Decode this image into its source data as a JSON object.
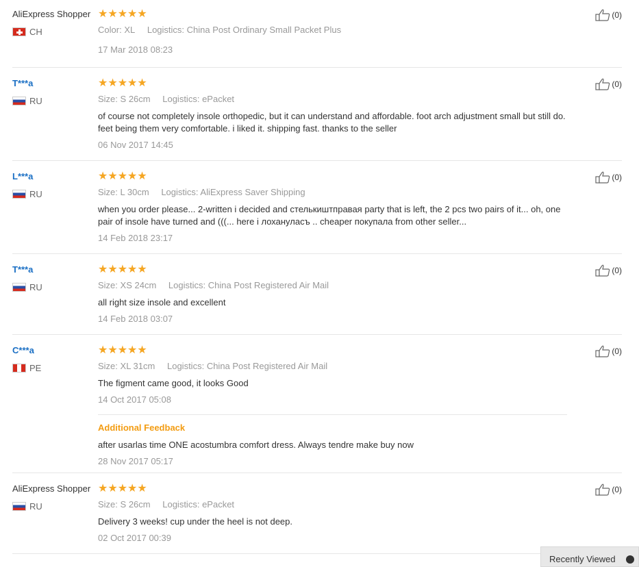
{
  "reviews": [
    {
      "user": "AliExpress Shopper",
      "masked": false,
      "country": "CH",
      "flag": "ch",
      "stars": 5,
      "attr_label": "Color:",
      "attr_value": "XL",
      "logistics_label": "Logistics:",
      "logistics_value": "China Post Ordinary Small Packet Plus",
      "text": "",
      "date": "17 Mar 2018 08:23",
      "helpful": "(0)"
    },
    {
      "user": "T***a",
      "masked": true,
      "country": "RU",
      "flag": "ru",
      "stars": 5,
      "attr_label": "Size:",
      "attr_value": "S 26cm",
      "logistics_label": "Logistics:",
      "logistics_value": "ePacket",
      "text": "of course not completely insole orthopedic, but it can understand and affordable. foot arch adjustment small but still do. feet being them very comfortable. i liked it. shipping fast. thanks to the seller",
      "date": "06 Nov 2017 14:45",
      "helpful": "(0)"
    },
    {
      "user": "L***a",
      "masked": true,
      "country": "RU",
      "flag": "ru",
      "stars": 5,
      "attr_label": "Size:",
      "attr_value": "L 30cm",
      "logistics_label": "Logistics:",
      "logistics_value": "AliExpress Saver Shipping",
      "text": "when you order please... 2-written i decided and стелькиштправая party that is left, the 2 pcs two pairs of it... oh, one pair of insole have turned and (((... here i лохануласъ .. cheaper покупала from other seller...",
      "date": "14 Feb 2018 23:17",
      "helpful": "(0)"
    },
    {
      "user": "T***a",
      "masked": true,
      "country": "RU",
      "flag": "ru",
      "stars": 5,
      "attr_label": "Size:",
      "attr_value": "XS 24cm",
      "logistics_label": "Logistics:",
      "logistics_value": "China Post Registered Air Mail",
      "text": "all right size insole and excellent",
      "date": "14 Feb 2018 03:07",
      "helpful": "(0)"
    },
    {
      "user": "C***a",
      "masked": true,
      "country": "PE",
      "flag": "pe",
      "stars": 5,
      "attr_label": "Size:",
      "attr_value": "XL 31cm",
      "logistics_label": "Logistics:",
      "logistics_value": "China Post Registered Air Mail",
      "text": "The figment came good, it looks Good",
      "date": "14 Oct 2017 05:08",
      "helpful": "(0)",
      "additional_title": "Additional Feedback",
      "additional_text": "after usarlas time ONE acostumbra comfort dress. Always tendre make buy now",
      "additional_date": "28 Nov 2017 05:17"
    },
    {
      "user": "AliExpress Shopper",
      "masked": false,
      "country": "RU",
      "flag": "ru",
      "stars": 5,
      "attr_label": "Size:",
      "attr_value": "S 26cm",
      "logistics_label": "Logistics:",
      "logistics_value": "ePacket",
      "text": "Delivery 3 weeks! cup under the heel is not deep.",
      "date": "02 Oct 2017 00:39",
      "helpful": "(0)"
    }
  ],
  "recently_viewed": "Recently Viewed",
  "colors": {
    "star": "#f5a623",
    "user_link": "#1a6fc4",
    "additional": "#f39c12"
  },
  "icons": {
    "helpful": "thumbs-up-icon",
    "star": "star-icon"
  }
}
